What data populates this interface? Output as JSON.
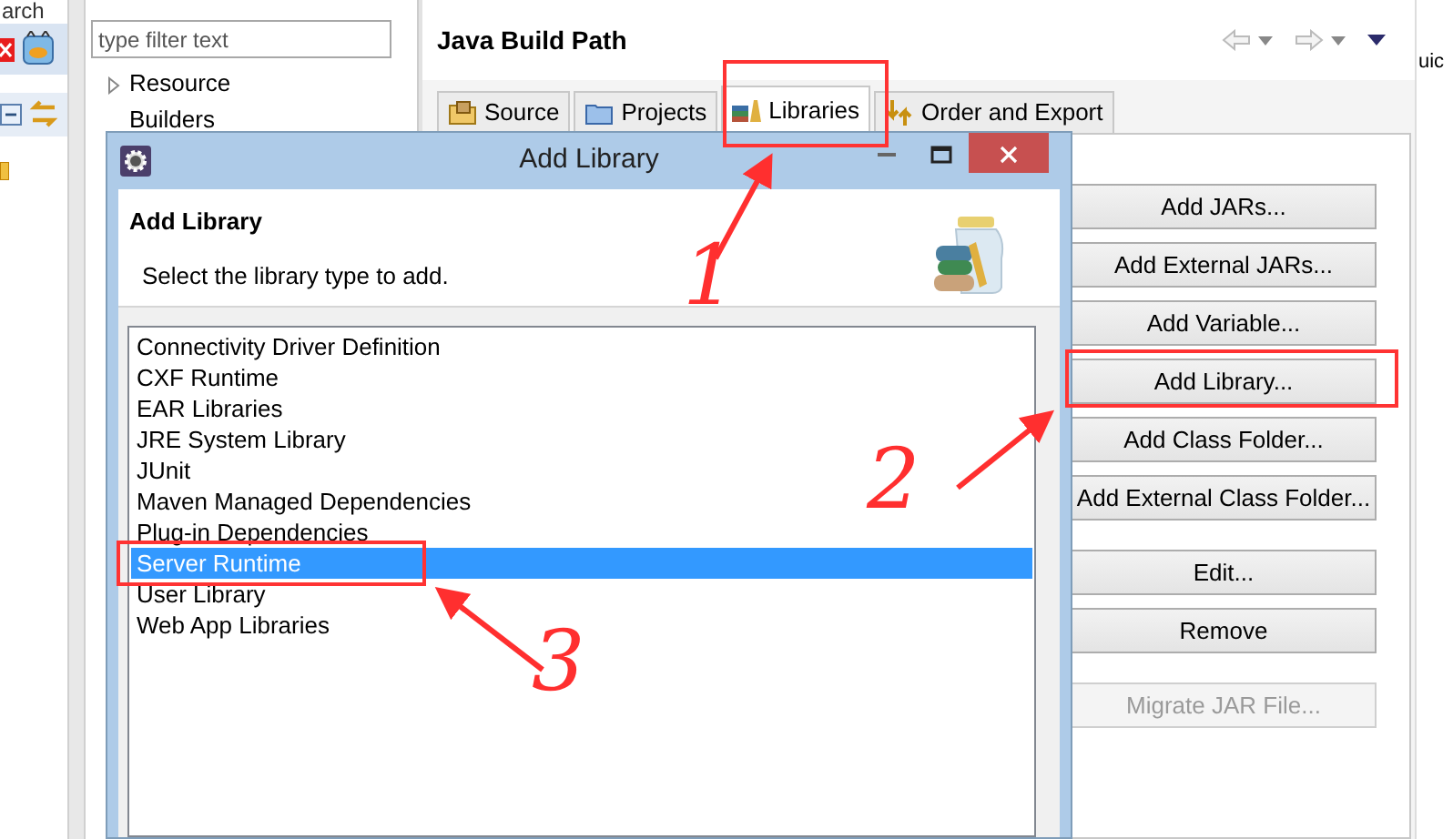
{
  "left_strip": {
    "cut_text": "arch"
  },
  "filter_field": {
    "placeholder": "type filter text"
  },
  "tree": [
    {
      "label": "Resource",
      "expandable": true
    },
    {
      "label": "Builders",
      "expandable": false
    }
  ],
  "page_title": "Java Build Path",
  "tabs": [
    {
      "label": "Source",
      "kind": "source",
      "selected": false
    },
    {
      "label": "Projects",
      "kind": "projects",
      "selected": false
    },
    {
      "label": "Libraries",
      "kind": "libraries",
      "selected": true
    },
    {
      "label": "Order and Export",
      "kind": "order",
      "selected": false
    }
  ],
  "button_groups": [
    [
      {
        "label": "Add JARs...",
        "disabled": false
      },
      {
        "label": "Add External JARs...",
        "disabled": false
      },
      {
        "label": "Add Variable...",
        "disabled": false
      },
      {
        "label": "Add Library...",
        "disabled": false
      },
      {
        "label": "Add Class Folder...",
        "disabled": false
      },
      {
        "label": "Add External Class Folder...",
        "disabled": false
      }
    ],
    [
      {
        "label": "Edit...",
        "disabled": false
      },
      {
        "label": "Remove",
        "disabled": false
      }
    ],
    [
      {
        "label": "Migrate JAR File...",
        "disabled": true
      }
    ]
  ],
  "right_strip": {
    "cut_text": "uic"
  },
  "dialog": {
    "title": "Add Library",
    "heading": "Add Library",
    "description": "Select the library type to add.",
    "items": [
      {
        "label": "Connectivity Driver Definition",
        "selected": false
      },
      {
        "label": "CXF Runtime",
        "selected": false
      },
      {
        "label": "EAR Libraries",
        "selected": false
      },
      {
        "label": "JRE System Library",
        "selected": false
      },
      {
        "label": "JUnit",
        "selected": false
      },
      {
        "label": "Maven Managed Dependencies",
        "selected": false
      },
      {
        "label": "Plug-in Dependencies",
        "selected": false
      },
      {
        "label": "Server Runtime",
        "selected": true
      },
      {
        "label": "User Library",
        "selected": false
      },
      {
        "label": "Web App Libraries",
        "selected": false
      }
    ]
  },
  "annotations": [
    {
      "number": "1"
    },
    {
      "number": "2"
    },
    {
      "number": "3"
    }
  ]
}
